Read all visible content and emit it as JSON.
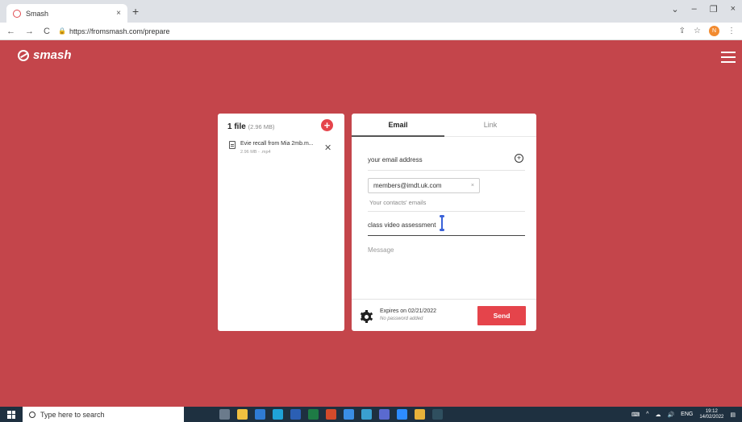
{
  "browser": {
    "tab_title": "Smash",
    "tab_close": "×",
    "new_tab": "+",
    "url": "https://fromsmash.com/prepare",
    "window_controls": [
      "⌄",
      "–",
      "❐",
      "×"
    ],
    "profile_initial": "N"
  },
  "site": {
    "logo_text": "smash"
  },
  "files": {
    "count_label": "1 file",
    "size_label": "(2.96 MB)",
    "add_label": "+",
    "items": [
      {
        "name": "Evie recall from Mia 2mb.m...",
        "meta": "2.96 MB - .mp4",
        "remove": "✕"
      }
    ]
  },
  "email_form": {
    "tab_email": "Email",
    "tab_link": "Link",
    "your_email_placeholder": "your email address",
    "contact_chip": "members@imdt.uk.com",
    "chip_remove": "×",
    "contacts_placeholder": "Your contacts' emails",
    "title_value": "class video assessment",
    "message_placeholder": "Message",
    "expires": "Expires on 02/21/2022",
    "password": "No password added",
    "send_label": "Send"
  },
  "taskbar": {
    "search_placeholder": "Type here to search",
    "language": "ENG",
    "time": "19:12",
    "date": "14/02/2022"
  },
  "colors": {
    "background": "#c4454b",
    "accent": "#e5444b",
    "taskbar": "#1e3040"
  }
}
